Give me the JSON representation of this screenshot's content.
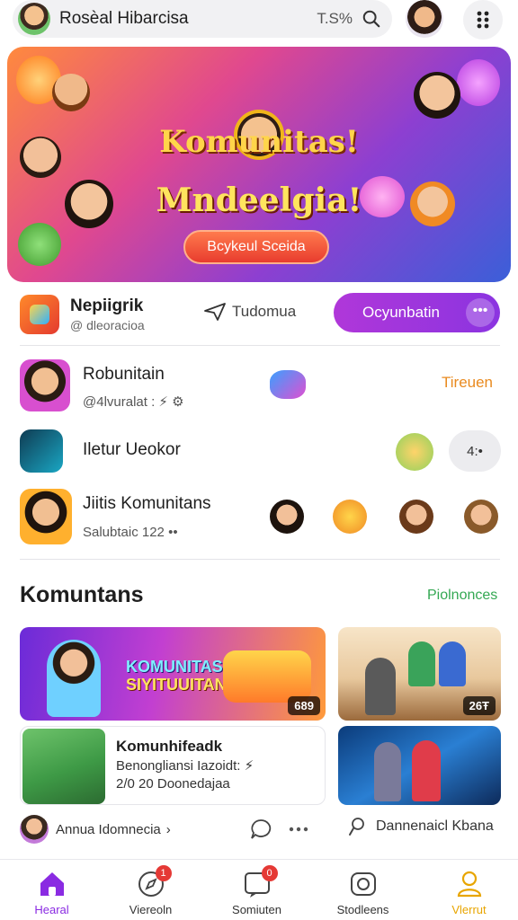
{
  "header": {
    "app_title": "Rosѐal Hibarcisa",
    "search_meta": "T.S%",
    "icons": {
      "search": "search-icon",
      "menu": "dots-menu-icon"
    }
  },
  "hero": {
    "title": "Komunitas!",
    "title2": "Mndeelgia!",
    "button_label": "Bcykeul Sceida"
  },
  "profile_row": {
    "name": "Nepiigrik",
    "handle": "@ dleoracioa",
    "tag_label": "Tudomua",
    "action_label": "Ocyunbatin",
    "more_label": "•••"
  },
  "communities": [
    {
      "title": "Robunitain",
      "subtitle": "@4lvuralat : ⚡ ⚙",
      "right_label": "Tireuen"
    },
    {
      "title": "Iletur Ueokor",
      "subtitle": "",
      "right_label": "4:•"
    },
    {
      "title": "Jiitis Komunitans",
      "subtitle": "Salubtaic 122 ••",
      "right_label": ""
    }
  ],
  "section": {
    "title": "Komuntans",
    "link": "Piolnonces"
  },
  "cards": {
    "banner_text1": "KOMUNITAS",
    "banner_text2": "SIYITUUITAN",
    "banner_badge": "689",
    "photo_badge": "26Ŧ",
    "white_title": "Komunhifeadk",
    "white_sub": "Benongliansi Iazoidt: ⚡",
    "white_meta": "2/0 20 Doonedajaa",
    "foot_left": "Annua Idomnecia",
    "foot_left_suffix": "›",
    "foot_right": "Dannenaicl Kbana"
  },
  "bottom_nav": [
    {
      "label": "Hearal",
      "icon": "home-icon",
      "badge": ""
    },
    {
      "label": "Viereoln",
      "icon": "compass-icon",
      "badge": "1"
    },
    {
      "label": "Somiuten",
      "icon": "chat-icon",
      "badge": "0"
    },
    {
      "label": "Stodleens",
      "icon": "camera-icon",
      "badge": ""
    },
    {
      "label": "Vlerrut",
      "icon": "profile-icon",
      "badge": ""
    }
  ],
  "colors": {
    "accent_purple": "#9b34dd",
    "link_green": "#34a853",
    "orange_text": "#e98a1f",
    "active_nav": "#8a2be2"
  }
}
